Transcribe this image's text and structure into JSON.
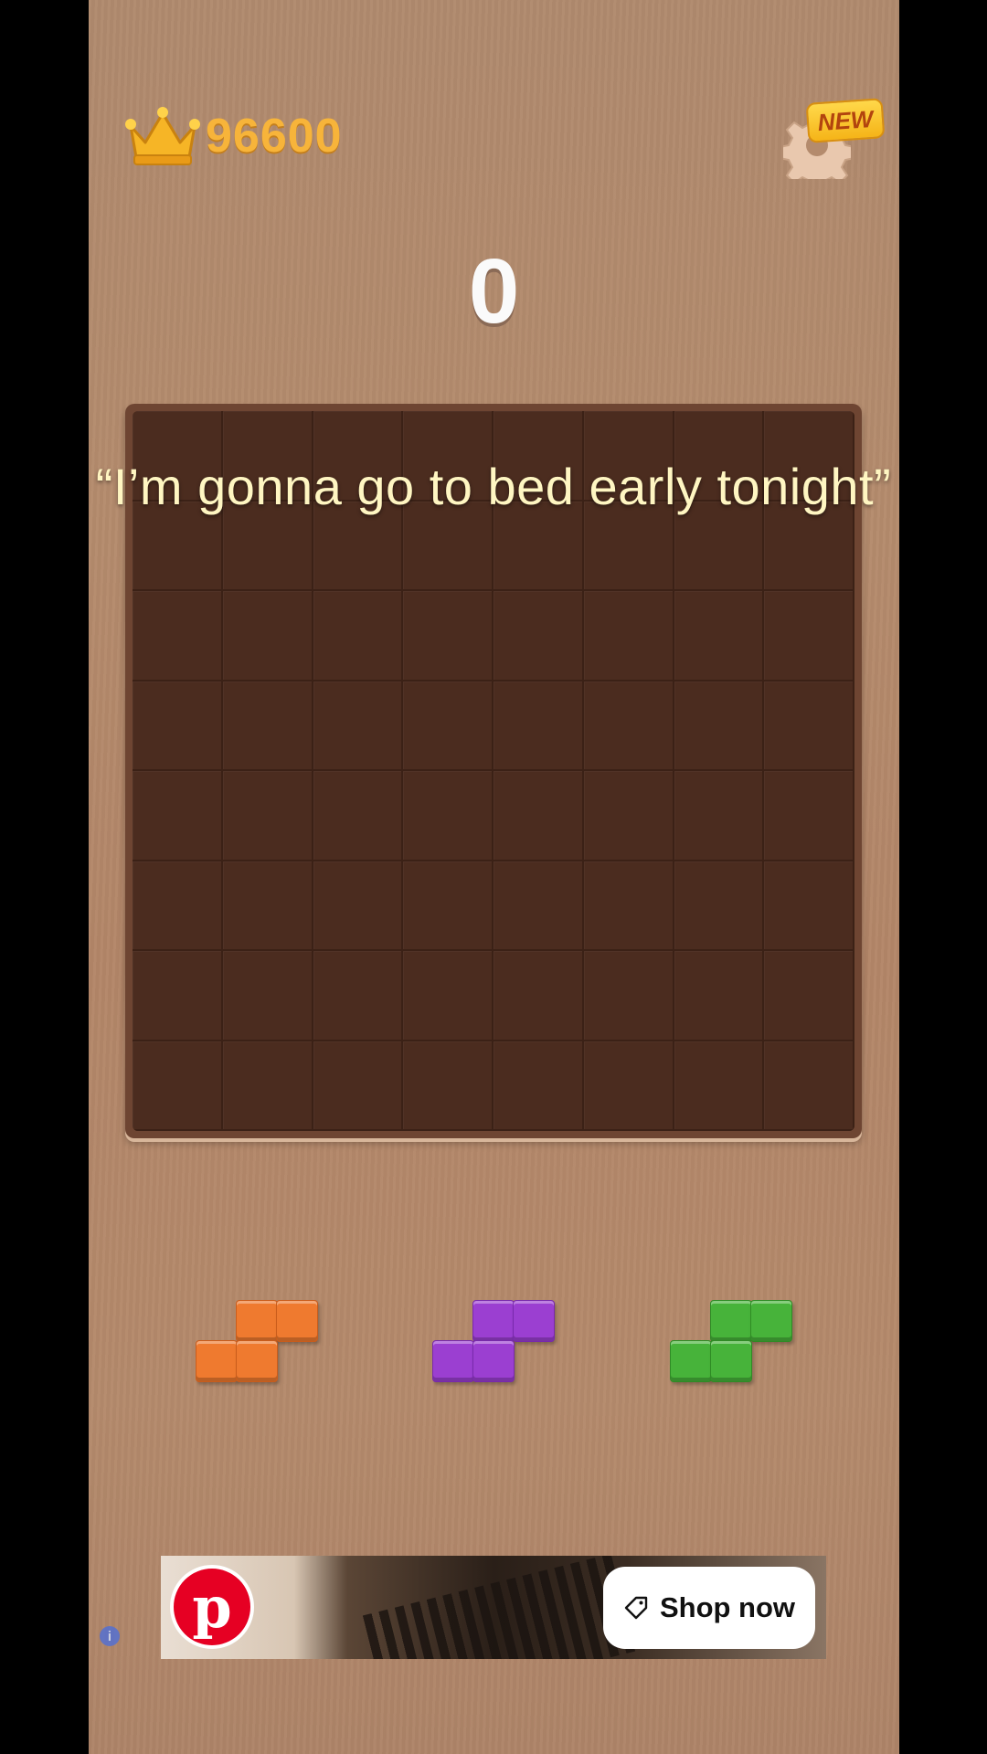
{
  "header": {
    "best_score": "96600",
    "settings_badge": "NEW"
  },
  "score": "0",
  "caption": "“I’m gonna go to bed early tonight”",
  "board": {
    "rows": 8,
    "cols": 8
  },
  "pieces": [
    {
      "color": "#ef7a2f",
      "shape": "s-tetromino"
    },
    {
      "color": "#9b3fd1",
      "shape": "s-tetromino"
    },
    {
      "color": "#47b33a",
      "shape": "s-tetromino"
    }
  ],
  "ad": {
    "brand_icon": "pinterest-icon",
    "cta_label": "Shop now",
    "cta_icon": "tag-icon",
    "info_icon": "i"
  },
  "colors": {
    "background": "#b48b6d",
    "board": "#4a2a1d",
    "best_score": "#f7b43a",
    "caption": "#fff6c2"
  }
}
